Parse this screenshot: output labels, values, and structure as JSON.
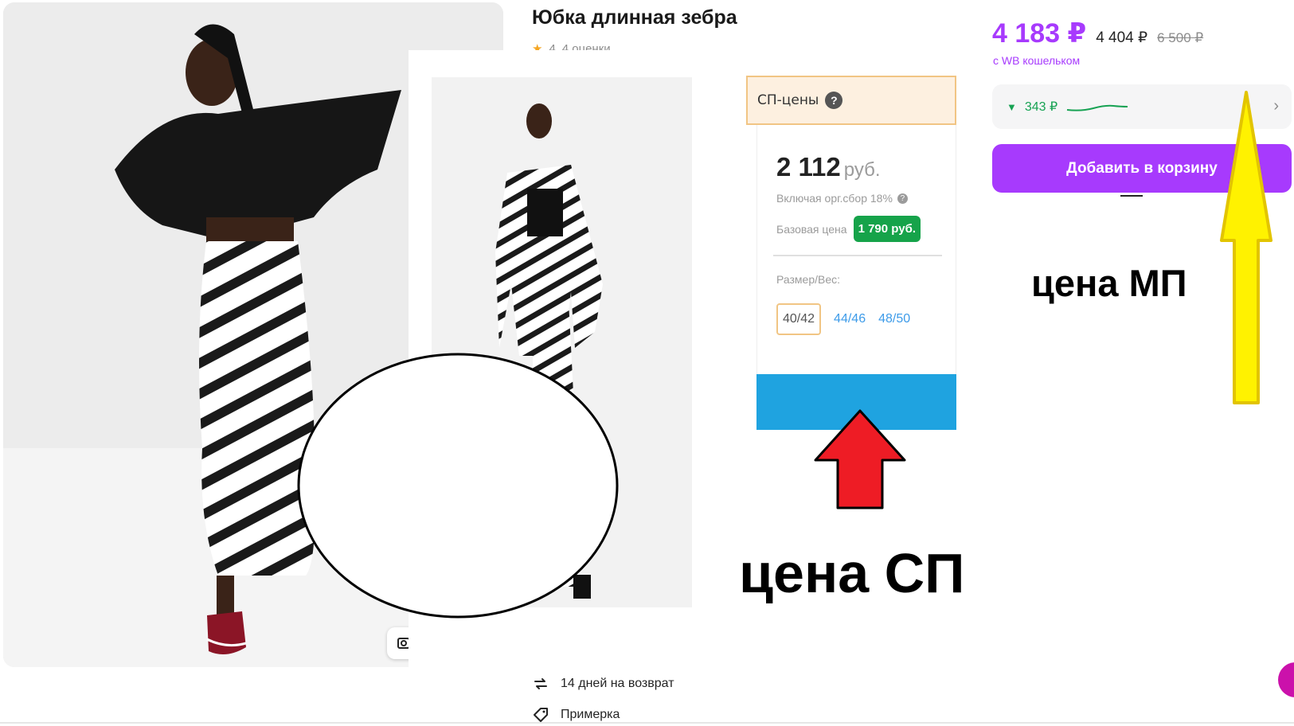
{
  "product": {
    "title": "Юбка длинная зебра",
    "rating_value": "4",
    "rating_count": "4 оценки"
  },
  "services": {
    "returns": "14 дней на возврат",
    "fitting": "Примерка"
  },
  "price_card": {
    "price": "4 183 ₽",
    "price_without_wallet": "4 404 ₽",
    "price_old": "6 500 ₽",
    "wallet_note": "с WB кошельком",
    "history_value": "343 ₽",
    "add_to_cart": "Добавить в корзину"
  },
  "sp_panel": {
    "tab_label": "СП-цены",
    "price_value": "2 112",
    "price_currency": "руб.",
    "fee_note": "Включая орг.сбор 18%",
    "base_label": "Базовая цена",
    "base_value": "1 790 руб.",
    "size_label": "Размер/Вес:",
    "sizes": [
      "40/42",
      "44/46",
      "48/50"
    ]
  },
  "annotations": {
    "label_sp": "цена СП",
    "label_mp": "цена МП"
  },
  "colors": {
    "accent_purple": "#a73afd",
    "sp_green": "#16a34a",
    "sp_blue": "#1fa3e0",
    "arrow_red": "#ee1c25",
    "arrow_yellow": "#fff200"
  },
  "icons": [
    "star-icon",
    "expand-icon",
    "return-icon",
    "tag-icon",
    "question-icon",
    "chevron-right-icon",
    "trend-down-icon"
  ]
}
